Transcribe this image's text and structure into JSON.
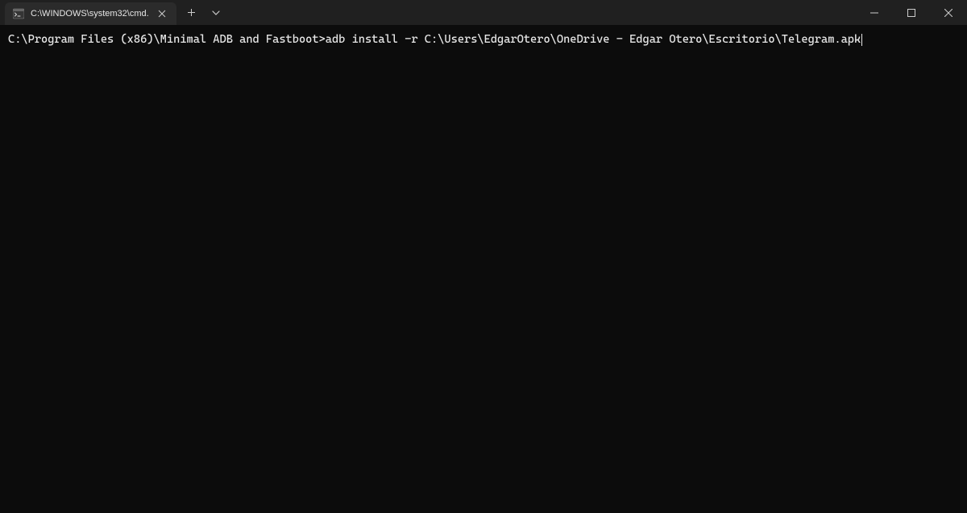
{
  "tab": {
    "title": "C:\\WINDOWS\\system32\\cmd."
  },
  "terminal": {
    "prompt": "C:\\Program Files (x86)\\Minimal ADB and Fastboot>",
    "command": "adb install -r C:\\Users\\EdgarOtero\\OneDrive - Edgar Otero\\Escritorio\\Telegram.apk"
  }
}
